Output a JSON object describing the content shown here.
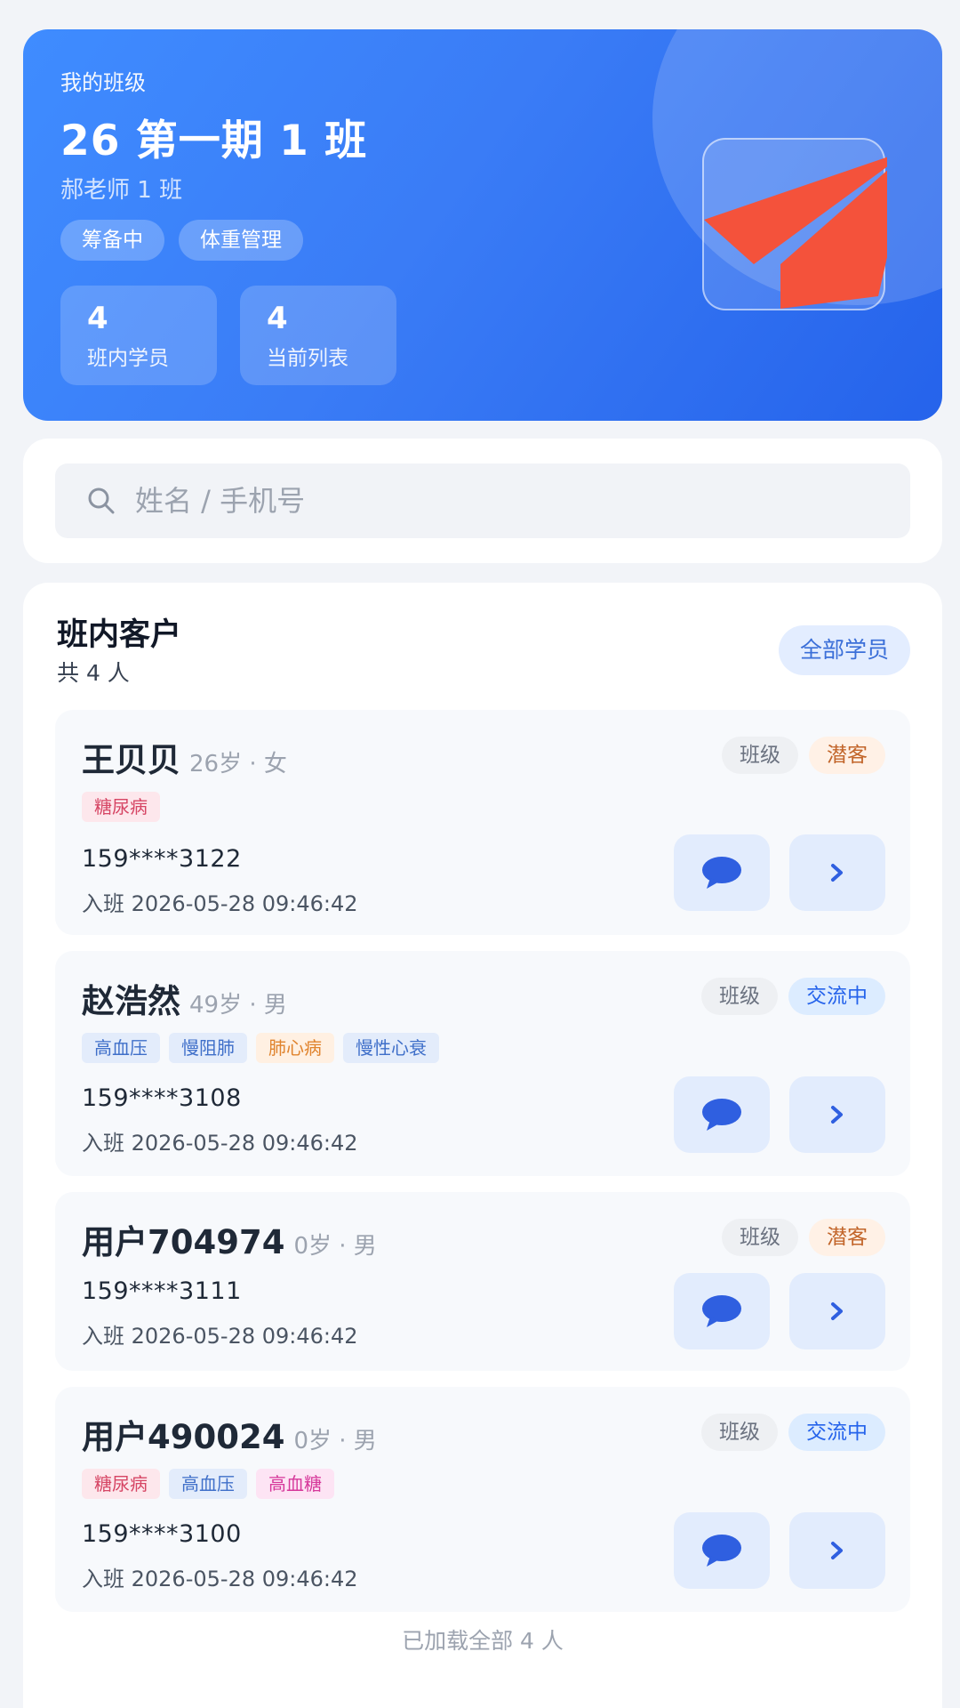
{
  "hero": {
    "eyebrow": "我的班级",
    "title": "26 第一期 1 班",
    "subtitle": "郝老师 1 班",
    "tags": [
      "筹备中",
      "体重管理"
    ],
    "stats": [
      {
        "value": "4",
        "label": "班内学员"
      },
      {
        "value": "4",
        "label": "当前列表"
      }
    ]
  },
  "search": {
    "placeholder": "姓名 / 手机号"
  },
  "list": {
    "title": "班内客户",
    "count": "共 4 人",
    "all_button": "全部学员",
    "footer": "已加载全部 4 人"
  },
  "clients": [
    {
      "name": "王贝贝",
      "meta": "26岁 · 女",
      "badges": [
        "班级",
        "潜客"
      ],
      "tags": [
        "糖尿病"
      ],
      "phone": "159****3122",
      "join": "入班 2026-05-28 09:46:42"
    },
    {
      "name": "赵浩然",
      "meta": "49岁 · 男",
      "badges": [
        "班级",
        "交流中"
      ],
      "tags": [
        "高血压",
        "慢阻肺",
        "肺心病",
        "慢性心衰"
      ],
      "phone": "159****3108",
      "join": "入班 2026-05-28 09:46:42"
    },
    {
      "name": "用户704974",
      "meta": "0岁 · 男",
      "badges": [
        "班级",
        "潜客"
      ],
      "tags": [],
      "phone": "159****3111",
      "join": "入班 2026-05-28 09:46:42"
    },
    {
      "name": "用户490024",
      "meta": "0岁 · 男",
      "badges": [
        "班级",
        "交流中"
      ],
      "tags": [
        "糖尿病",
        "高血压",
        "高血糖"
      ],
      "phone": "159****3100",
      "join": "入班 2026-05-28 09:46:42"
    }
  ],
  "colors": {
    "accent": "#3a7cf6",
    "logo": "#f4523b",
    "icon": "#2f5fe0"
  },
  "icons": {
    "search": "search-icon",
    "message": "chat-bubble-icon",
    "open": "chevron-right-icon"
  }
}
